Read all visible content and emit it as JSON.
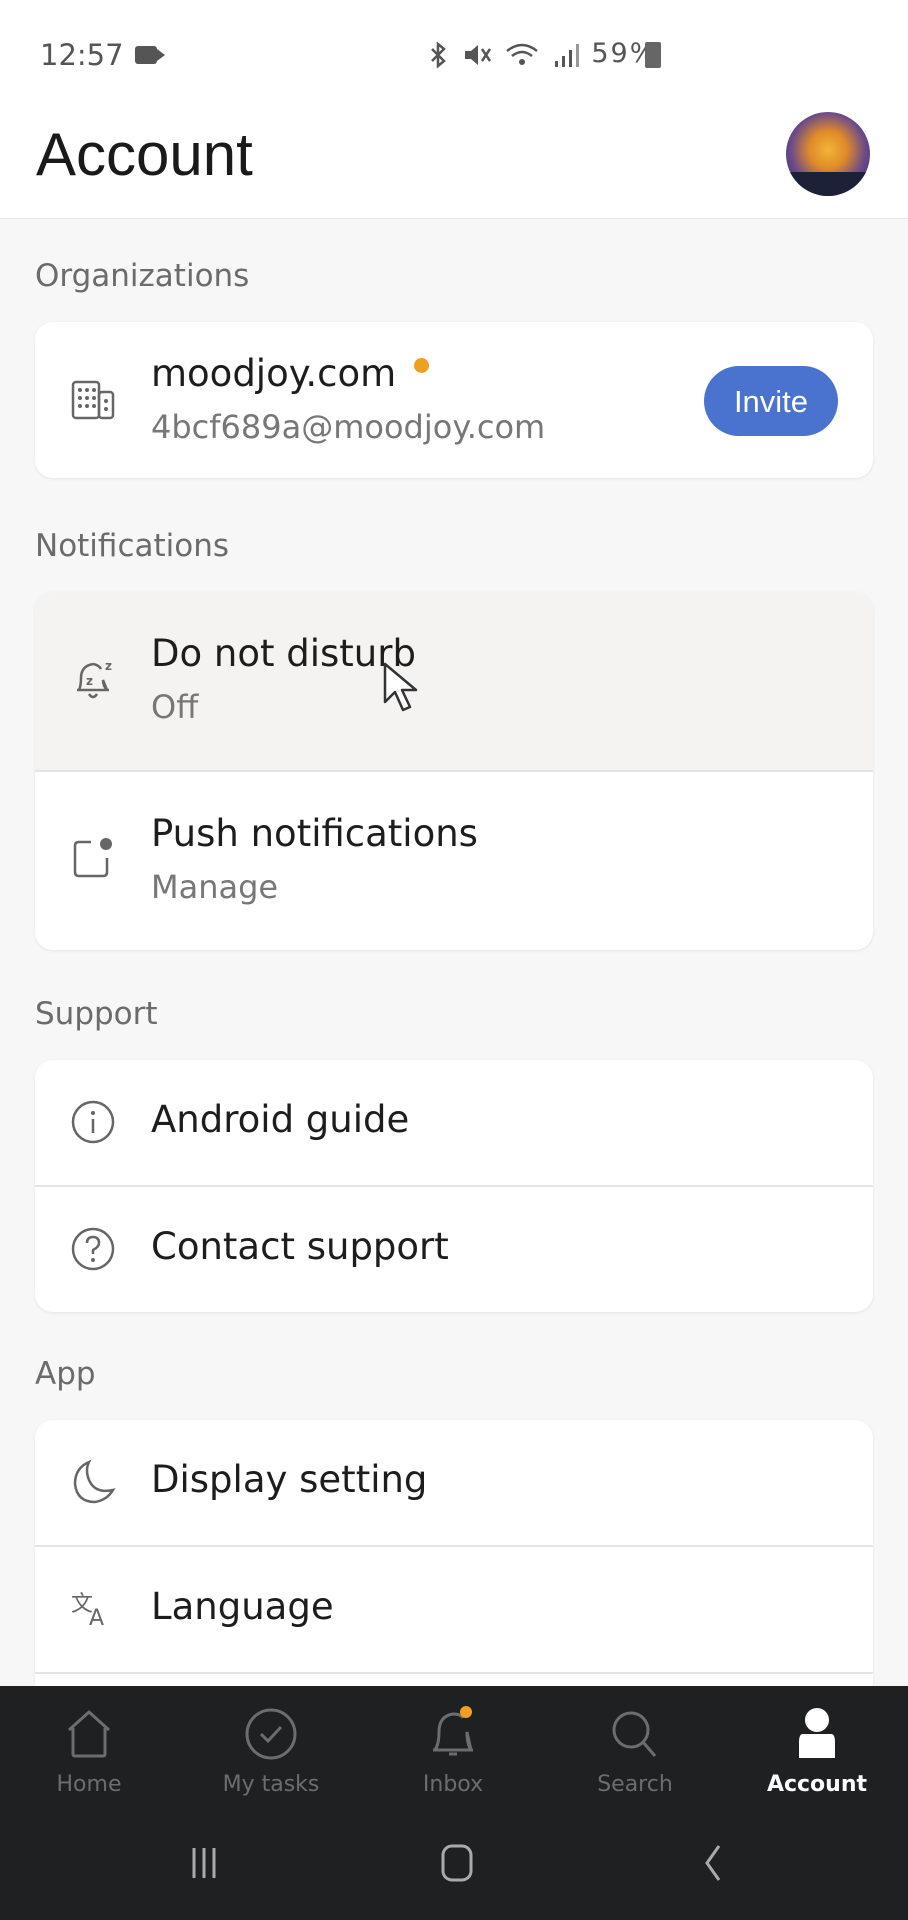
{
  "status_bar": {
    "time": "12:57",
    "icons": [
      "video-record-icon",
      "bluetooth-icon",
      "mute-icon",
      "wifi-icon",
      "signal-icon"
    ],
    "battery": "59%"
  },
  "header": {
    "title": "Account",
    "avatar_alt": "profile-avatar"
  },
  "sections": {
    "organizations": {
      "label": "Organizations",
      "org_name": "moodjoy.com",
      "org_email": "4bcf689a@moodjoy.com",
      "invite_label": "Invite",
      "status_dot_color": "#f0a020"
    },
    "notifications": {
      "label": "Notifications",
      "items": [
        {
          "title": "Do not disturb",
          "subtitle": "Off",
          "icon": "bell-snooze-icon"
        },
        {
          "title": "Push notifications",
          "subtitle": "Manage",
          "icon": "push-notification-icon"
        }
      ]
    },
    "support": {
      "label": "Support",
      "items": [
        {
          "title": "Android guide",
          "icon": "info-icon"
        },
        {
          "title": "Contact support",
          "icon": "help-icon"
        }
      ]
    },
    "app": {
      "label": "App",
      "items": [
        {
          "title": "Display setting",
          "icon": "moon-icon"
        },
        {
          "title": "Language",
          "icon": "translate-icon"
        }
      ]
    }
  },
  "bottom_nav": {
    "items": [
      {
        "label": "Home",
        "icon": "home-icon"
      },
      {
        "label": "My tasks",
        "icon": "check-circle-icon"
      },
      {
        "label": "Inbox",
        "icon": "bell-icon",
        "badge": true
      },
      {
        "label": "Search",
        "icon": "search-icon"
      },
      {
        "label": "Account",
        "icon": "person-icon",
        "active": true
      }
    ]
  },
  "colors": {
    "accent": "#4a73cf",
    "badge": "#f0a020",
    "nav_background": "#1f2021"
  }
}
